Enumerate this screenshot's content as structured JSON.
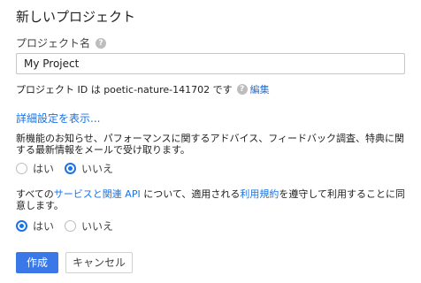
{
  "dialog": {
    "title": "新しいプロジェクト"
  },
  "project_name": {
    "label": "プロジェクト名",
    "value": "My Project"
  },
  "project_id": {
    "text": "プロジェクト ID は poetic-nature-141702 です",
    "edit_label": "編集"
  },
  "advanced_link": "詳細設定を表示...",
  "updates": {
    "text": "新機能のお知らせ、パフォーマンスに関するアドバイス、フィードバック調査、特典に関する最新情報をメールで受け取ります。",
    "options": [
      "はい",
      "いいえ"
    ],
    "selected": "いいえ"
  },
  "terms": {
    "text_prefix": "すべての",
    "services_link": "サービスと関連 API",
    "text_middle": " について、適用される",
    "terms_link": "利用規約",
    "text_suffix": "を遵守して利用することに同意します。",
    "options": [
      "はい",
      "いいえ"
    ],
    "selected": "はい"
  },
  "buttons": {
    "create": "作成",
    "cancel": "キャンセル"
  },
  "colors": {
    "accent": "#1a73e8",
    "primary_button": "#3b78e7"
  }
}
